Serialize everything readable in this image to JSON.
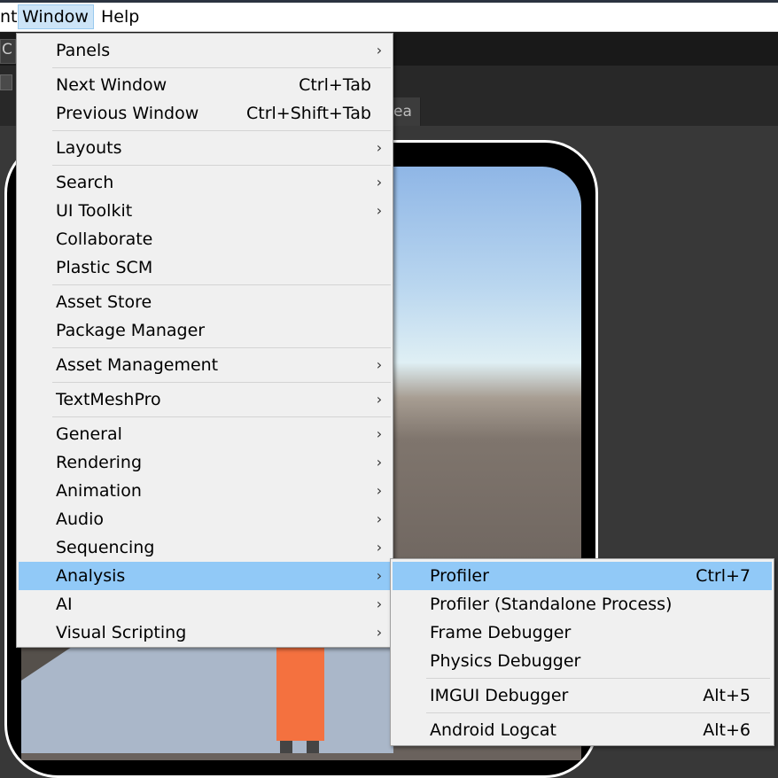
{
  "menubar": {
    "items": [
      {
        "label": "nt",
        "active": false
      },
      {
        "label": "Window",
        "active": true
      },
      {
        "label": "Help",
        "active": false
      }
    ]
  },
  "background": {
    "toolbar_fragment": "C",
    "tab_fragment": "ea"
  },
  "window_menu": {
    "groups": [
      [
        {
          "label": "Panels",
          "shortcut": "",
          "submenu": true
        }
      ],
      [
        {
          "label": "Next Window",
          "shortcut": "Ctrl+Tab",
          "submenu": false
        },
        {
          "label": "Previous Window",
          "shortcut": "Ctrl+Shift+Tab",
          "submenu": false
        }
      ],
      [
        {
          "label": "Layouts",
          "shortcut": "",
          "submenu": true
        }
      ],
      [
        {
          "label": "Search",
          "shortcut": "",
          "submenu": true
        },
        {
          "label": "UI Toolkit",
          "shortcut": "",
          "submenu": true
        },
        {
          "label": "Collaborate",
          "shortcut": "",
          "submenu": false
        },
        {
          "label": "Plastic SCM",
          "shortcut": "",
          "submenu": false
        }
      ],
      [
        {
          "label": "Asset Store",
          "shortcut": "",
          "submenu": false
        },
        {
          "label": "Package Manager",
          "shortcut": "",
          "submenu": false
        }
      ],
      [
        {
          "label": "Asset Management",
          "shortcut": "",
          "submenu": true
        }
      ],
      [
        {
          "label": "TextMeshPro",
          "shortcut": "",
          "submenu": true
        }
      ],
      [
        {
          "label": "General",
          "shortcut": "",
          "submenu": true
        },
        {
          "label": "Rendering",
          "shortcut": "",
          "submenu": true
        },
        {
          "label": "Animation",
          "shortcut": "",
          "submenu": true
        },
        {
          "label": "Audio",
          "shortcut": "",
          "submenu": true
        },
        {
          "label": "Sequencing",
          "shortcut": "",
          "submenu": true
        },
        {
          "label": "Analysis",
          "shortcut": "",
          "submenu": true,
          "highlighted": true
        },
        {
          "label": "AI",
          "shortcut": "",
          "submenu": true
        },
        {
          "label": "Visual Scripting",
          "shortcut": "",
          "submenu": true
        }
      ]
    ]
  },
  "analysis_submenu": {
    "groups": [
      [
        {
          "label": "Profiler",
          "shortcut": "Ctrl+7",
          "highlighted": true
        },
        {
          "label": "Profiler (Standalone Process)",
          "shortcut": ""
        },
        {
          "label": "Frame Debugger",
          "shortcut": ""
        },
        {
          "label": "Physics Debugger",
          "shortcut": ""
        }
      ],
      [
        {
          "label": "IMGUI Debugger",
          "shortcut": "Alt+5"
        }
      ],
      [
        {
          "label": "Android Logcat",
          "shortcut": "Alt+6"
        }
      ]
    ]
  },
  "icons": {
    "submenu_arrow": "›"
  },
  "colors": {
    "highlight": "#91c9f7",
    "menu_bg": "#f0f0f0",
    "menubar_active": "#cce4f7",
    "character": "#f4713f"
  }
}
